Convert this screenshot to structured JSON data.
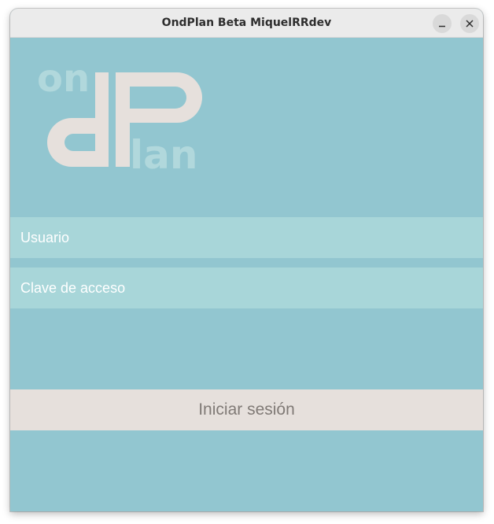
{
  "window": {
    "title": "OndPlan Beta MiquelRRdev",
    "minimize_label": "–",
    "close_label": "×"
  },
  "logo": {
    "text_on": "on",
    "text_d": "d",
    "text_p": "P",
    "text_lan": "lan"
  },
  "form": {
    "username_placeholder": "Usuario",
    "password_placeholder": "Clave de acceso",
    "submit_label": "Iniciar sesión"
  },
  "colors": {
    "background": "#92c6d0",
    "field_background": "#a8d6d9",
    "button_background": "#e6e0dc",
    "button_text": "#807a76",
    "logo_light": "#e6e0dc",
    "logo_faint": "#b1d8dc"
  }
}
